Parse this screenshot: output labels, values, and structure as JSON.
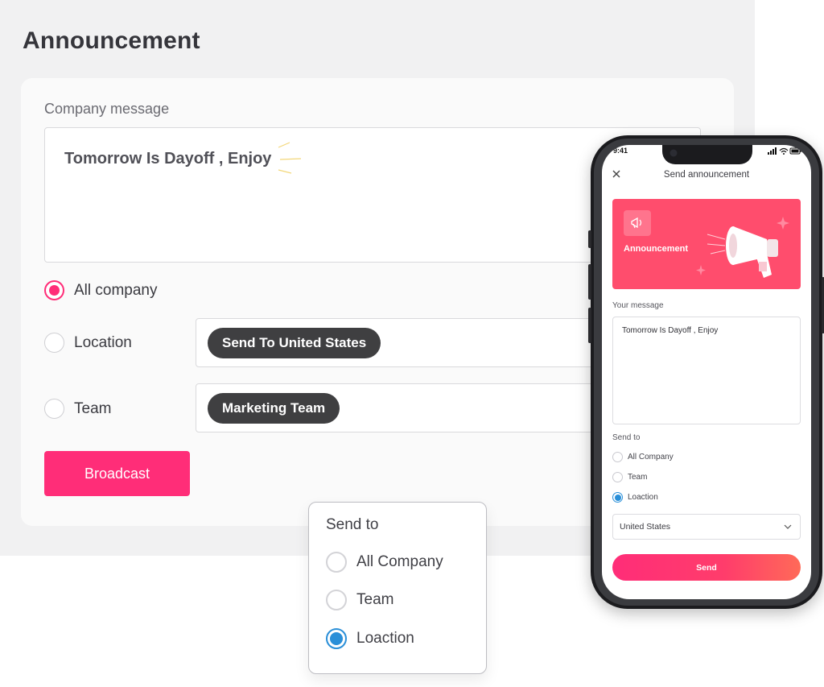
{
  "desktop": {
    "title": "Announcement",
    "message_label": "Company message",
    "message_value": "Tomorrow Is Dayoff , Enjoy",
    "options": {
      "all_company": "All company",
      "location": "Location",
      "team": "Team"
    },
    "selected_option": "all_company",
    "location_chip": "Send To United States",
    "team_chip": "Marketing Team",
    "broadcast_label": "Broadcast"
  },
  "popup": {
    "title": "Send to",
    "options": [
      "All Company",
      "Team",
      "Loaction"
    ],
    "selected": "Loaction"
  },
  "phone": {
    "status_time": "9:41",
    "header_title": "Send announcement",
    "banner_label": "Announcement",
    "message_label": "Your message",
    "message_value": "Tomorrow Is Dayoff , Enjoy",
    "send_to_label": "Send to",
    "options": [
      "All Company",
      "Team",
      "Loaction"
    ],
    "selected": "Loaction",
    "select_value": "United States",
    "send_label": "Send"
  },
  "colors": {
    "accent_pink": "#ff2d78",
    "banner_red": "#ff4d6d",
    "radio_blue": "#2a8fd8"
  }
}
